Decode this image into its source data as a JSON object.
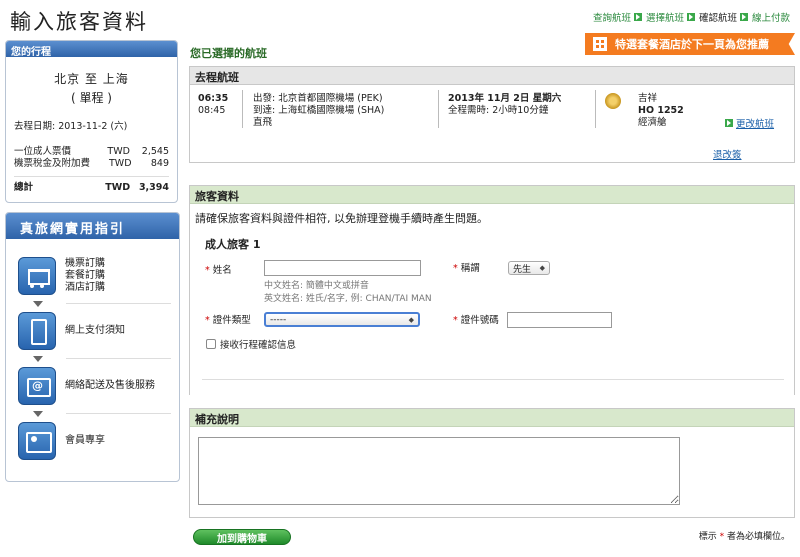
{
  "page": {
    "title": "輸入旅客資料"
  },
  "steps": [
    {
      "label": "查詢航班",
      "current": false
    },
    {
      "label": "選擇航班",
      "current": false
    },
    {
      "label": "確認航班",
      "current": true
    },
    {
      "label": "線上付款",
      "current": false
    }
  ],
  "promo": {
    "label": "特選套餐酒店於下一頁為您推薦"
  },
  "trip": {
    "header": "您的行程",
    "route": "北京 至 上海",
    "trip_type": "( 單程 )",
    "date": "去程日期: 2013-11-2 (六)",
    "fares": [
      {
        "label": "一位成人票價",
        "currency": "TWD",
        "amount": "2,545"
      },
      {
        "label": "機票稅金及附加費",
        "currency": "TWD",
        "amount": "849"
      }
    ],
    "total": {
      "label": "總計",
      "currency": "TWD",
      "amount": "3,394"
    }
  },
  "guide": {
    "header": "真旅網實用指引",
    "items": [
      {
        "lines": [
          "機票訂購",
          "套餐訂購",
          "酒店訂購"
        ]
      },
      {
        "lines": [
          "網上支付須知"
        ]
      },
      {
        "lines": [
          "網絡配送及售後服務"
        ]
      },
      {
        "lines": [
          "會員專享"
        ]
      }
    ]
  },
  "flight": {
    "selected_label": "您已選擇的航班",
    "header": "去程航班",
    "depart_time": "06:35",
    "arrive_time": "08:45",
    "depart": "出發: 北京首都國際機場 (PEK)",
    "arrive": "到達: 上海虹橋國際機場 (SHA)",
    "stops": "直飛",
    "date": "2013年 11月 2日 星期六",
    "duration": "全程需時: 2小時10分鐘",
    "airline": "吉祥",
    "flight_no": "HO 1252",
    "cabin": "經濟艙",
    "change_link": "更改航班",
    "refund_link": "退改簽"
  },
  "passenger": {
    "header": "旅客資料",
    "note": "請確保旅客資料與證件相符, 以免辦理登機手續時產生問題。",
    "adult_label": "成人旅客 1",
    "name_label": "姓名",
    "name_value": "",
    "hint_cn": "中文姓名: 簡體中文或拼音",
    "hint_en": "英文姓名: 姓氏/名字, 例: CHAN/TAI MAN",
    "title_label": "稱謂",
    "title_value": "先生",
    "idtype_label": "證件類型",
    "idtype_value": "-----",
    "idno_label": "證件號碼",
    "idno_value": "",
    "confirm_label": "接收行程確認信息"
  },
  "remarks": {
    "header": "補充說明",
    "value": ""
  },
  "footer": {
    "add_cart": "加到購物車",
    "req_prefix": "標示",
    "req_star": "*",
    "req_suffix": "者為必填欄位。"
  },
  "colors": {
    "accent_green": "#2b8a3e",
    "promo_orange": "#f47b20",
    "nav_blue": "#2f63a8"
  }
}
